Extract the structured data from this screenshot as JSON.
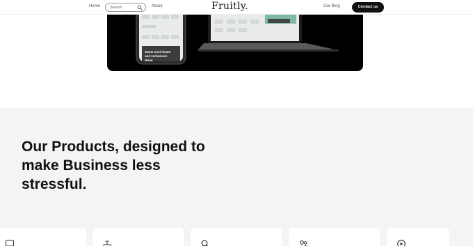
{
  "header": {
    "nav_home": "Home",
    "search_placeholder": "Search",
    "nav_about": "About",
    "logo": "Fruitly.",
    "nav_blog": "Our Blog",
    "contact_label": "Contact us"
  },
  "hero": {
    "phone_caption": "Starte noch heute und verbessere deine"
  },
  "products": {
    "title": "Our Products, designed to make Business less stressful.",
    "cards": [
      {
        "icon": "monitor-icon"
      },
      {
        "icon": "router-icon"
      },
      {
        "icon": "search-icon"
      },
      {
        "icon": "users-icon"
      },
      {
        "icon": "play-icon"
      }
    ]
  },
  "colors": {
    "accent": "#111111",
    "section_bg": "#f4f4f5",
    "screen_accent": "#7fb7a8"
  }
}
